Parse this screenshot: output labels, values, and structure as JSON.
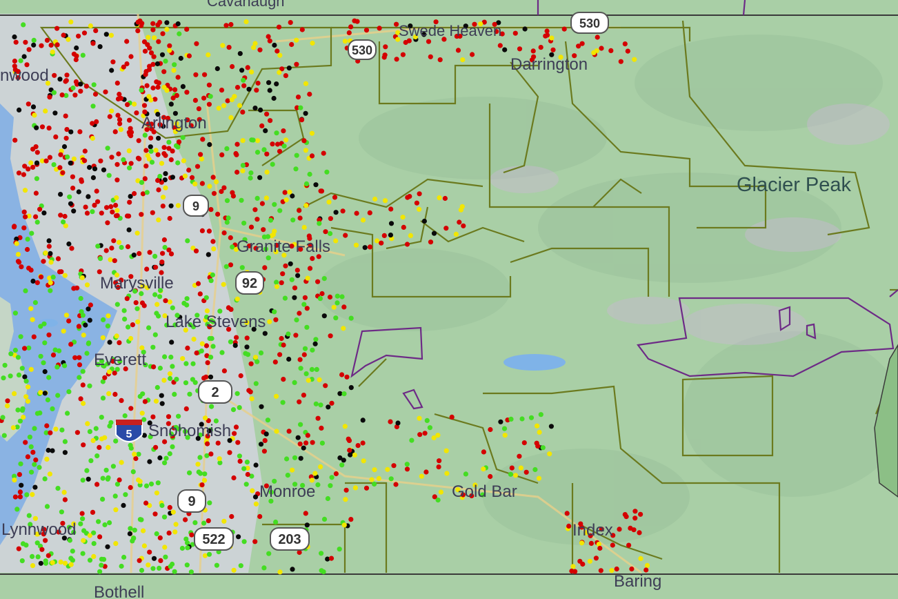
{
  "map": {
    "colors": {
      "land": "#a9cfa6",
      "land_dark": "#8fbf92",
      "urban": "#c8cfd8",
      "water": "#8ab3e3",
      "boundary": "#6b7a1e",
      "county_line": "#3a3a3a",
      "tribal": "#6d2a86"
    },
    "places": [
      {
        "id": "cavanaugh",
        "label": "Cavanaugh"
      },
      {
        "id": "swede-heaven",
        "label": "Swede Heaven"
      },
      {
        "id": "darrington",
        "label": "Darrington"
      },
      {
        "id": "arlington",
        "label": "Arlington"
      },
      {
        "id": "glacier-peak",
        "label": "Glacier Peak"
      },
      {
        "id": "granite-falls",
        "label": "Granite Falls"
      },
      {
        "id": "marysville",
        "label": "Marysville"
      },
      {
        "id": "lake-stevens",
        "label": "Lake Stevens"
      },
      {
        "id": "everett",
        "label": "Everett"
      },
      {
        "id": "snohomish",
        "label": "Snohomish"
      },
      {
        "id": "monroe",
        "label": "Monroe"
      },
      {
        "id": "gold-bar",
        "label": "Gold Bar"
      },
      {
        "id": "index",
        "label": "Index"
      },
      {
        "id": "lynnwood",
        "label": "Lynnwood"
      },
      {
        "id": "baring",
        "label": "Baring"
      },
      {
        "id": "bothell",
        "label": "Bothell"
      },
      {
        "id": "oso",
        "label": "nwood"
      }
    ],
    "shields": [
      {
        "id": "r530a",
        "label": "530"
      },
      {
        "id": "r530b",
        "label": "530"
      },
      {
        "id": "r9a",
        "label": "9"
      },
      {
        "id": "r92",
        "label": "92"
      },
      {
        "id": "r2",
        "label": "2"
      },
      {
        "id": "i5",
        "label": "5"
      },
      {
        "id": "r9b",
        "label": "9"
      },
      {
        "id": "r522",
        "label": "522"
      },
      {
        "id": "r203",
        "label": "203"
      }
    ],
    "dot_colors": {
      "red": "#d40000",
      "green": "#44dd22",
      "yellow": "#f2e600",
      "black": "#0a0a0a",
      "cyan": "#4ad9e0"
    }
  }
}
